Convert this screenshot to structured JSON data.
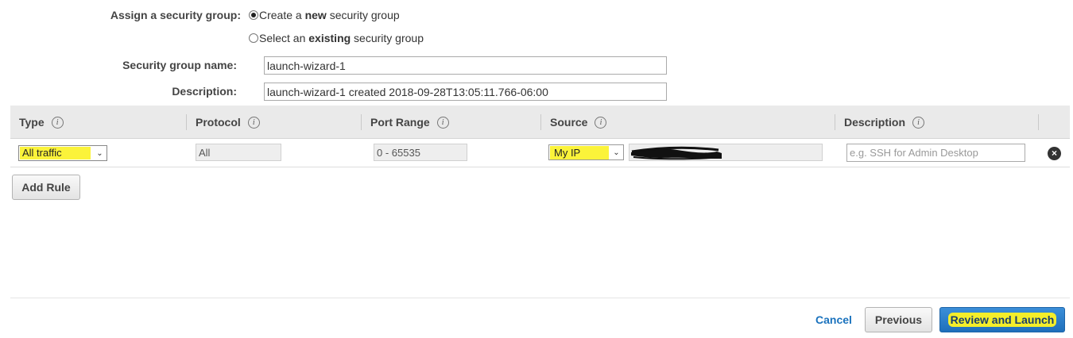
{
  "assign_security_group": {
    "label": "Assign a security group:",
    "options": [
      {
        "prefix": "Create a ",
        "bold": "new",
        "suffix": " security group",
        "checked": true
      },
      {
        "prefix": "Select an ",
        "bold": "existing",
        "suffix": " security group",
        "checked": false
      }
    ]
  },
  "security_group_name": {
    "label": "Security group name:",
    "value": "launch-wizard-1"
  },
  "description_field": {
    "label": "Description:",
    "value": "launch-wizard-1 created 2018-09-28T13:05:11.766-06:00"
  },
  "rules_table": {
    "headers": [
      "Type",
      "Protocol",
      "Port Range",
      "Source",
      "Description"
    ],
    "info_icon": "info-icon",
    "rows": [
      {
        "type": "All traffic",
        "protocol": "All",
        "port_range": "0 - 65535",
        "source": "My IP",
        "source_value_redacted": true,
        "description_placeholder": "e.g. SSH for Admin Desktop",
        "remove_icon": "close-circle-icon"
      }
    ]
  },
  "add_rule_button": "Add Rule",
  "footer": {
    "cancel": "Cancel",
    "previous": "Previous",
    "review_and_launch": "Review and Launch"
  },
  "colors": {
    "highlight": "#fbf33a",
    "primary": "#1f6fbb",
    "link": "#1a72bd",
    "header_bg": "#eaeaea"
  }
}
